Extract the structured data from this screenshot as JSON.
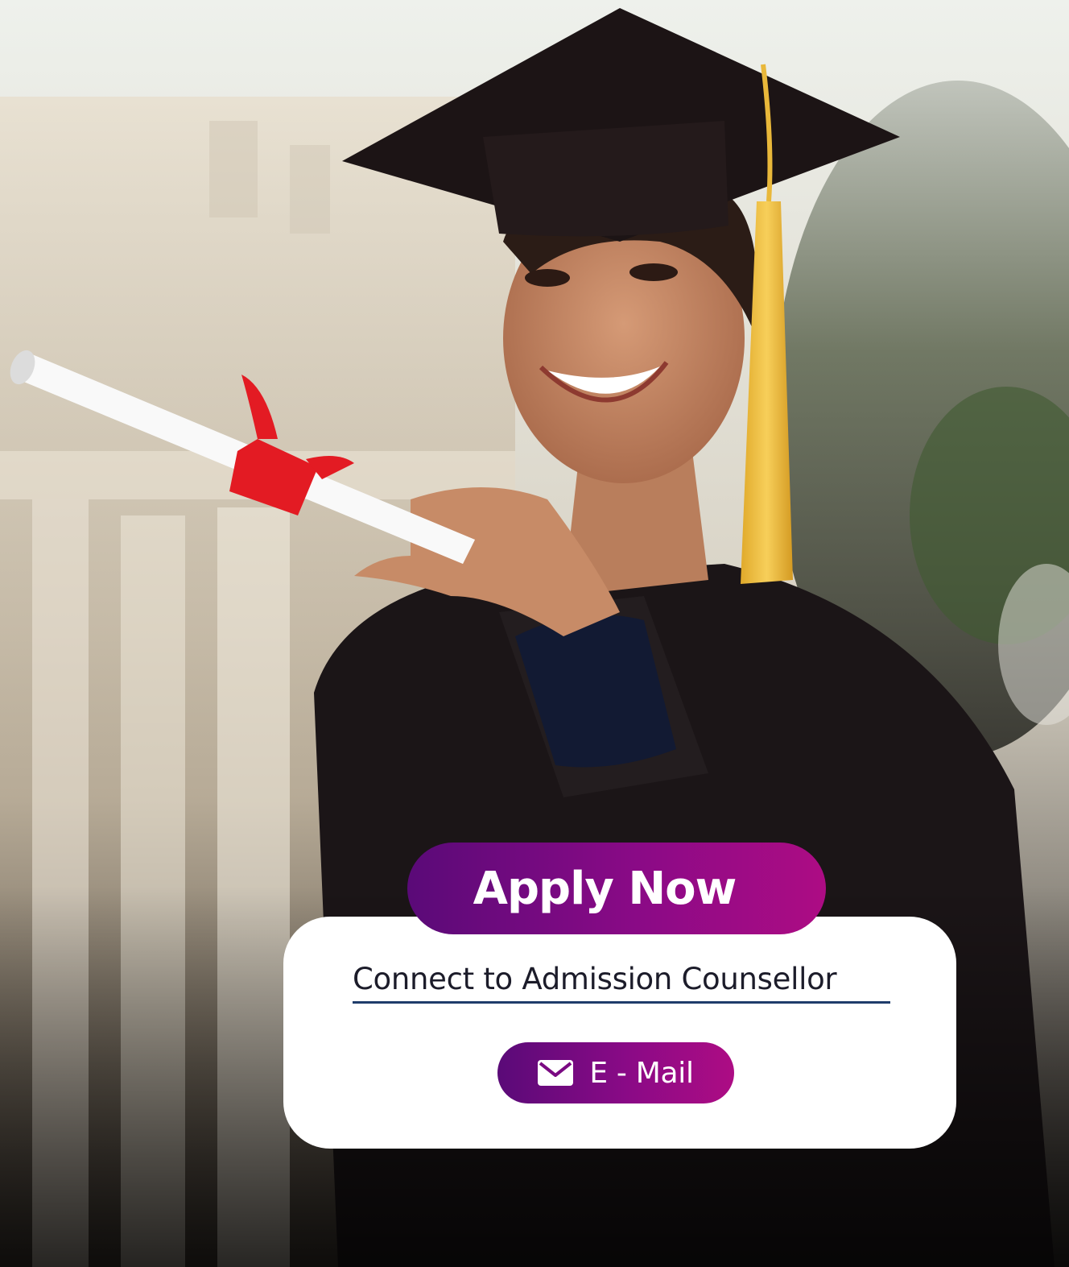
{
  "hero": {
    "image_description_icon": "graduate-photo"
  },
  "cta": {
    "apply_label": "Apply Now"
  },
  "contact_card": {
    "counsellor_link_label": "Connect to Admission Counsellor",
    "email_button_label": "E - Mail",
    "email_icon": "mail-icon"
  },
  "colors": {
    "gradient_start": "#5a0a78",
    "gradient_end": "#ad0c84",
    "link_underline": "#1f3c6b",
    "card_background": "#ffffff"
  }
}
